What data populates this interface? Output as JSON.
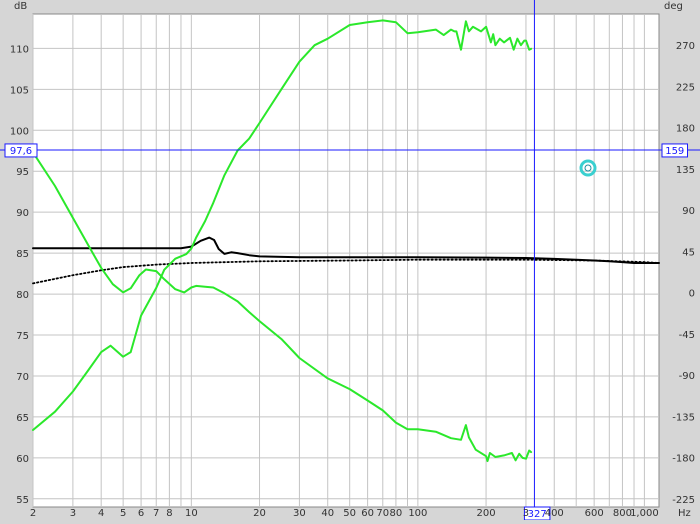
{
  "chart_data": {
    "type": "line",
    "left_axis": {
      "unit_label": "dB",
      "ticks": [
        55,
        60,
        65,
        70,
        75,
        80,
        85,
        90,
        95,
        100,
        105,
        110
      ],
      "range": [
        54,
        114.2
      ]
    },
    "right_axis": {
      "unit_label": "deg",
      "ticks": [
        -225,
        -180,
        -135,
        -90,
        -45,
        0,
        45,
        90,
        135,
        180,
        225,
        270
      ],
      "range": [
        -234,
        304
      ]
    },
    "x_axis": {
      "unit_label": "Hz",
      "scale": "log",
      "range": [
        2,
        1160
      ],
      "tick_labels": [
        {
          "value": 2,
          "label": "2"
        },
        {
          "value": 3,
          "label": "3"
        },
        {
          "value": 4,
          "label": "4"
        },
        {
          "value": 5,
          "label": "5"
        },
        {
          "value": 6,
          "label": "6"
        },
        {
          "value": 7,
          "label": "7"
        },
        {
          "value": 8,
          "label": "8"
        },
        {
          "value": 10,
          "label": "10"
        },
        {
          "value": 20,
          "label": "20"
        },
        {
          "value": 30,
          "label": "30"
        },
        {
          "value": 40,
          "label": "40"
        },
        {
          "value": 50,
          "label": "50"
        },
        {
          "value": 60,
          "label": "60"
        },
        {
          "value": 70,
          "label": "70"
        },
        {
          "value": 80,
          "label": "80"
        },
        {
          "value": 100,
          "label": "100"
        },
        {
          "value": 200,
          "label": "200"
        },
        {
          "value": 300,
          "label": "3"
        },
        {
          "value": 400,
          "label": "400"
        },
        {
          "value": 600,
          "label": "600"
        },
        {
          "value": 800,
          "label": "800"
        },
        {
          "value": 1000,
          "label": "1,000"
        }
      ],
      "minor_gridlines": [
        9,
        90,
        500,
        700,
        900
      ]
    },
    "cursor": {
      "x_value": 327,
      "x_label": "327",
      "left_value": 97.6,
      "left_label": "97,6",
      "right_label": "159"
    },
    "grid": true,
    "series": [
      {
        "axis": "left",
        "color": "#000000",
        "style": "solid",
        "points": [
          [
            2,
            85.6
          ],
          [
            3,
            85.6
          ],
          [
            5,
            85.6
          ],
          [
            7,
            85.6
          ],
          [
            9,
            85.6
          ],
          [
            10,
            85.8
          ],
          [
            11,
            86.5
          ],
          [
            12,
            86.9
          ],
          [
            12.6,
            86.6
          ],
          [
            13.2,
            85.5
          ],
          [
            14,
            84.9
          ],
          [
            15,
            85.1
          ],
          [
            16,
            85.0
          ],
          [
            18,
            84.75
          ],
          [
            20,
            84.6
          ],
          [
            30,
            84.5
          ],
          [
            50,
            84.5
          ],
          [
            100,
            84.5
          ],
          [
            200,
            84.45
          ],
          [
            300,
            84.4
          ],
          [
            400,
            84.3
          ],
          [
            500,
            84.2
          ],
          [
            600,
            84.1
          ],
          [
            700,
            84.0
          ],
          [
            800,
            83.9
          ],
          [
            900,
            83.8
          ],
          [
            1000,
            83.8
          ],
          [
            1160,
            83.8
          ]
        ]
      },
      {
        "axis": "left",
        "color": "#000000",
        "style": "dotted",
        "points": [
          [
            2,
            81.3
          ],
          [
            3,
            82.3
          ],
          [
            4,
            82.9
          ],
          [
            5,
            83.3
          ],
          [
            7,
            83.6
          ],
          [
            10,
            83.8
          ],
          [
            20,
            84.0
          ],
          [
            50,
            84.1
          ],
          [
            100,
            84.2
          ],
          [
            300,
            84.2
          ],
          [
            600,
            84.1
          ],
          [
            1000,
            83.9
          ],
          [
            1160,
            83.8
          ]
        ]
      },
      {
        "axis": "left",
        "color": "#2be82b",
        "style": "solid",
        "points": [
          [
            2,
            97.3
          ],
          [
            2.5,
            93.2
          ],
          [
            3,
            89.3
          ],
          [
            3.5,
            86.0
          ],
          [
            4,
            83.2
          ],
          [
            4.5,
            81.2
          ],
          [
            5,
            80.2
          ],
          [
            5.4,
            80.7
          ],
          [
            5.9,
            82.3
          ],
          [
            6.3,
            83.0
          ],
          [
            7,
            82.8
          ],
          [
            7.6,
            81.8
          ],
          [
            8.5,
            80.6
          ],
          [
            9.3,
            80.2
          ],
          [
            10,
            80.8
          ],
          [
            10.5,
            81.0
          ],
          [
            11.5,
            80.9
          ],
          [
            12.5,
            80.8
          ],
          [
            14,
            80.1
          ],
          [
            16,
            79.1
          ],
          [
            18,
            77.8
          ],
          [
            20,
            76.7
          ],
          [
            25,
            74.5
          ],
          [
            30,
            72.2
          ],
          [
            40,
            69.7
          ],
          [
            50,
            68.4
          ],
          [
            60,
            67.0
          ],
          [
            70,
            65.8
          ],
          [
            80,
            64.3
          ],
          [
            90,
            63.5
          ],
          [
            100,
            63.5
          ],
          [
            120,
            63.2
          ],
          [
            140,
            62.4
          ],
          [
            155,
            62.2
          ],
          [
            163,
            64.0
          ],
          [
            168,
            62.5
          ],
          [
            180,
            61.0
          ],
          [
            200,
            60.2
          ],
          [
            203,
            59.6
          ],
          [
            208,
            60.6
          ],
          [
            220,
            60.1
          ],
          [
            240,
            60.3
          ],
          [
            260,
            60.6
          ],
          [
            270,
            59.7
          ],
          [
            280,
            60.5
          ],
          [
            290,
            60.0
          ],
          [
            300,
            59.9
          ],
          [
            310,
            60.9
          ],
          [
            316,
            60.7
          ]
        ]
      },
      {
        "axis": "right",
        "color": "#2be82b",
        "style": "solid",
        "points": [
          [
            2,
            -150
          ],
          [
            2.5,
            -130
          ],
          [
            3,
            -108
          ],
          [
            3.5,
            -85
          ],
          [
            4,
            -65
          ],
          [
            4.4,
            -58
          ],
          [
            5,
            -70
          ],
          [
            5.4,
            -65
          ],
          [
            6,
            -25
          ],
          [
            7,
            5
          ],
          [
            7.6,
            25
          ],
          [
            8.5,
            37
          ],
          [
            9.5,
            42
          ],
          [
            10,
            48
          ],
          [
            10.5,
            60
          ],
          [
            11.5,
            78
          ],
          [
            12.5,
            98
          ],
          [
            14,
            128
          ],
          [
            16,
            155
          ],
          [
            18,
            168
          ],
          [
            20,
            185
          ],
          [
            25,
            222
          ],
          [
            30,
            252
          ],
          [
            35,
            270
          ],
          [
            40,
            277
          ],
          [
            50,
            292
          ],
          [
            60,
            295
          ],
          [
            70,
            297
          ],
          [
            80,
            295
          ],
          [
            90,
            283
          ],
          [
            100,
            284
          ],
          [
            120,
            287
          ],
          [
            130,
            281
          ],
          [
            140,
            287
          ],
          [
            145,
            285
          ],
          [
            148,
            285
          ],
          [
            155,
            265
          ],
          [
            163,
            296
          ],
          [
            168,
            285
          ],
          [
            175,
            290
          ],
          [
            190,
            285
          ],
          [
            200,
            290
          ],
          [
            210,
            273
          ],
          [
            215,
            282
          ],
          [
            220,
            270
          ],
          [
            230,
            277
          ],
          [
            240,
            273
          ],
          [
            255,
            278
          ],
          [
            265,
            265
          ],
          [
            275,
            277
          ],
          [
            285,
            270
          ],
          [
            295,
            275
          ],
          [
            300,
            275
          ],
          [
            310,
            265
          ],
          [
            316,
            266
          ]
        ]
      }
    ]
  }
}
